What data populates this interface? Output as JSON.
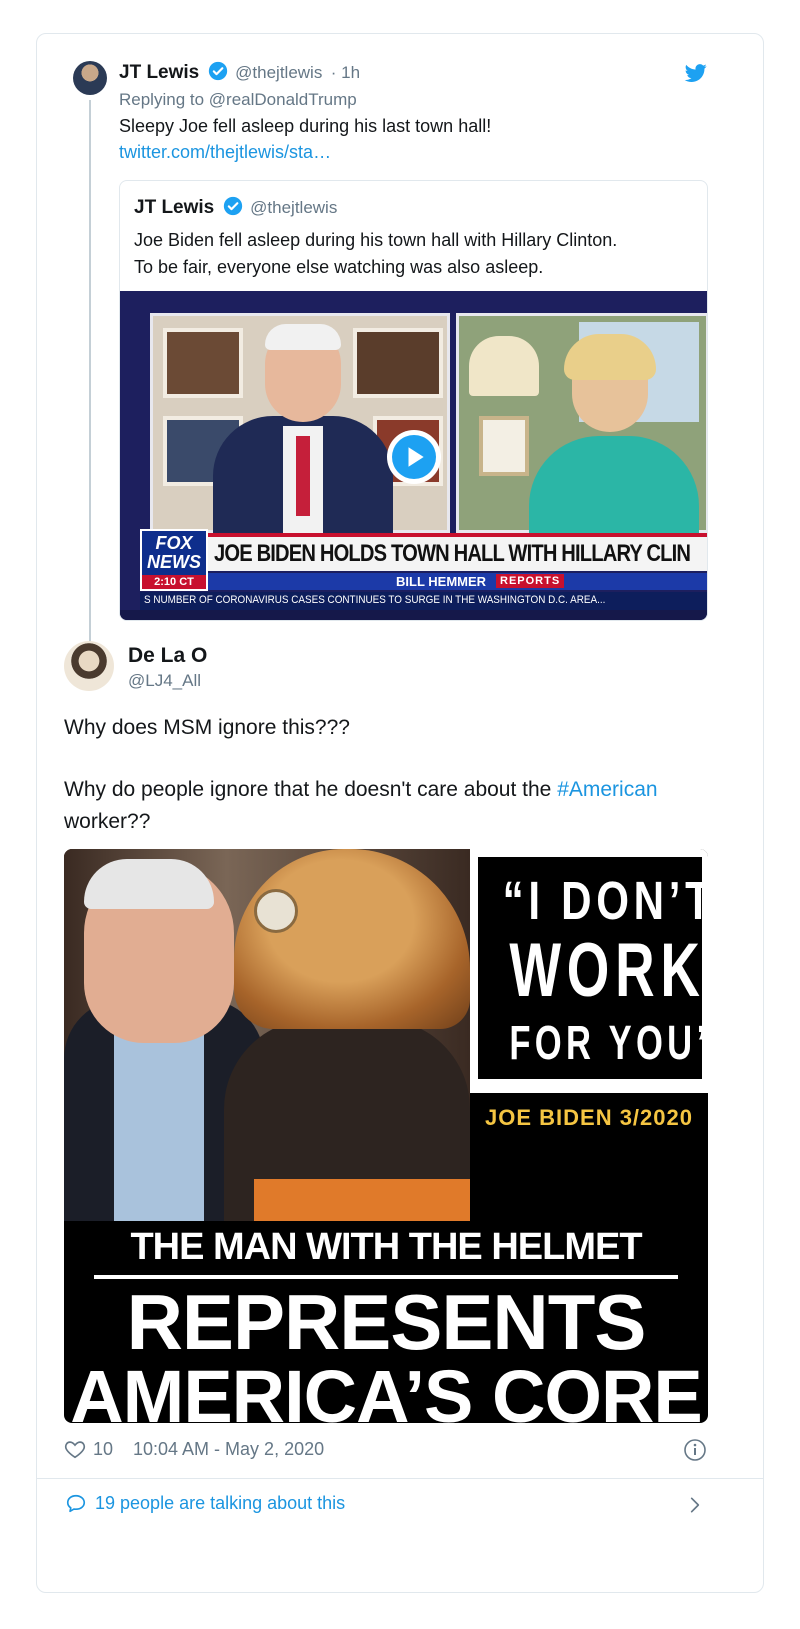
{
  "reply_tweet": {
    "author_name": "JT Lewis",
    "handle": "@thejtlewis",
    "time": "· 1h",
    "replying_to_prefix": "Replying to ",
    "replying_to_handle": "@realDonaldTrump",
    "text": "Sleepy Joe fell asleep during his last town hall!",
    "link": "twitter.com/thejtlewis/sta…"
  },
  "quoted_tweet": {
    "author_name": "JT Lewis",
    "handle": "@thejtlewis",
    "text_line1": "Joe Biden fell asleep during his town hall with Hillary Clinton.",
    "text_line2": "To be fair, everyone else watching was also asleep.",
    "video": {
      "network": "FOX NEWS",
      "network_line1": "FOX",
      "network_line2": "NEWS",
      "clock": "2:10 CT",
      "headline": "JOE BIDEN HOLDS TOWN HALL WITH HILLARY CLIN",
      "show_host": "BILL HEMMER",
      "show_tag": "REPORTS",
      "ticker": "S NUMBER OF CORONAVIRUS CASES CONTINUES TO SURGE IN THE WASHINGTON D.C. AREA..."
    }
  },
  "main_tweet": {
    "author_name": "De La O",
    "handle": "@LJ4_All",
    "paragraph1": "Why does MSM ignore this???",
    "paragraph2_prefix": "Why do people ignore that he doesn't care about the ",
    "paragraph2_hashtag": "#American",
    "paragraph2_suffix": "worker??",
    "image": {
      "quote_line1": "“I DON’T",
      "quote_line2": "WORK",
      "quote_line3": "FOR YOU”",
      "attribution": "JOE BIDEN 3/2020",
      "caption_line1": "THE MAN WITH THE HELMET",
      "caption_line2": "REPRESENTS",
      "caption_line3": "AMERICA’S CORE"
    },
    "likes": "10",
    "timestamp": "10:04 AM - May 2, 2020",
    "talking_text": "19 people are talking about this"
  },
  "colors": {
    "twitter_blue": "#1da1f2",
    "link_blue": "#1b95e0",
    "gray": "#657786",
    "fox_red": "#c8102e",
    "gold": "#f5c542"
  }
}
